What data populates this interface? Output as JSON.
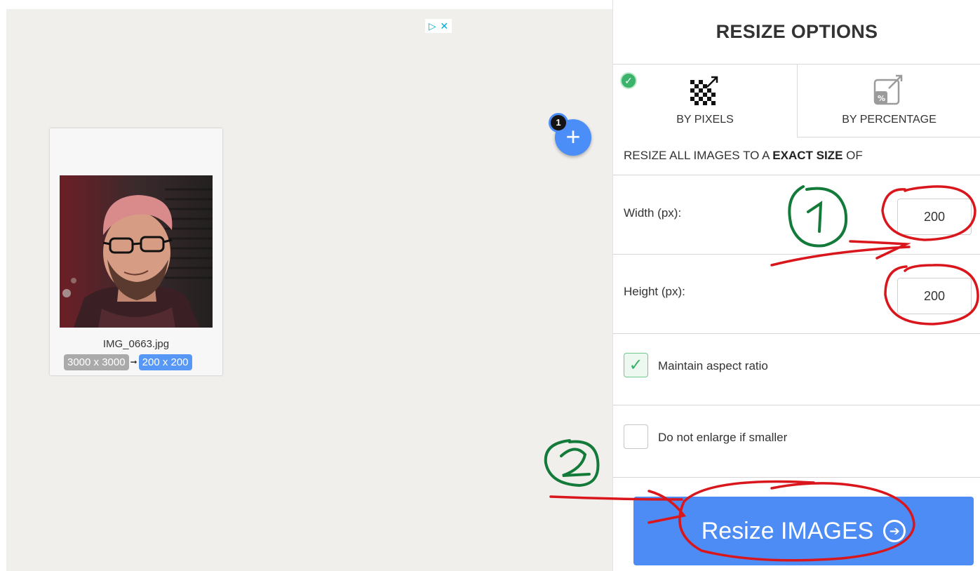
{
  "ad": {
    "play_icon": "▷",
    "close_icon": "✕"
  },
  "image_card": {
    "filename": "IMG_0663.jpg",
    "original_size": "3000 x 3000",
    "arrow": "➞",
    "new_size": "200 x 200"
  },
  "add_button": {
    "label": "+",
    "count": "1"
  },
  "panel": {
    "title": "RESIZE OPTIONS",
    "tabs": [
      {
        "label": "BY PIXELS",
        "icon": "pixels-resize-icon",
        "active": true
      },
      {
        "label": "BY PERCENTAGE",
        "icon": "percent-resize-icon",
        "active": false
      }
    ],
    "instruction_prefix": "RESIZE ALL IMAGES TO A ",
    "instruction_bold": "EXACT SIZE",
    "instruction_suffix": " OF",
    "width_label": "Width (px):",
    "width_value": "200",
    "height_label": "Height (px):",
    "height_value": "200",
    "maintain_aspect_label": "Maintain aspect ratio",
    "maintain_aspect_checked": true,
    "no_enlarge_label": "Do not enlarge if smaller",
    "no_enlarge_checked": false,
    "resize_button_label": "Resize IMAGES",
    "resize_button_icon": "➔"
  },
  "colors": {
    "accent": "#4d8cf4",
    "success": "#3bb36a",
    "annotation_red": "#d9161c",
    "annotation_green": "#137a3a"
  }
}
